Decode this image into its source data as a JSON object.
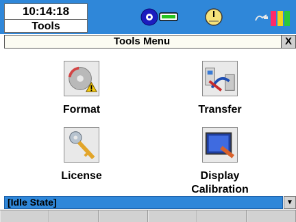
{
  "status_bar": {
    "time": "10:14:18",
    "mode": "Tools",
    "icons": [
      "cd-usb-icon",
      "meter-gauge-icon",
      "battery-power-icon"
    ]
  },
  "menu": {
    "title": "Tools Menu",
    "close_label": "X",
    "items": [
      {
        "label": "Format",
        "icon": "format-disk-icon"
      },
      {
        "label": "Transfer",
        "icon": "transfer-icon"
      },
      {
        "label": "License",
        "icon": "license-key-icon"
      },
      {
        "label": "Display",
        "label2": "Calibration",
        "icon": "display-calibration-icon"
      }
    ]
  },
  "footer": {
    "status": "[Idle State]",
    "scroll_label": "▼"
  },
  "colors": {
    "accent": "#2f87d9",
    "panel": "#fbfbf2"
  }
}
